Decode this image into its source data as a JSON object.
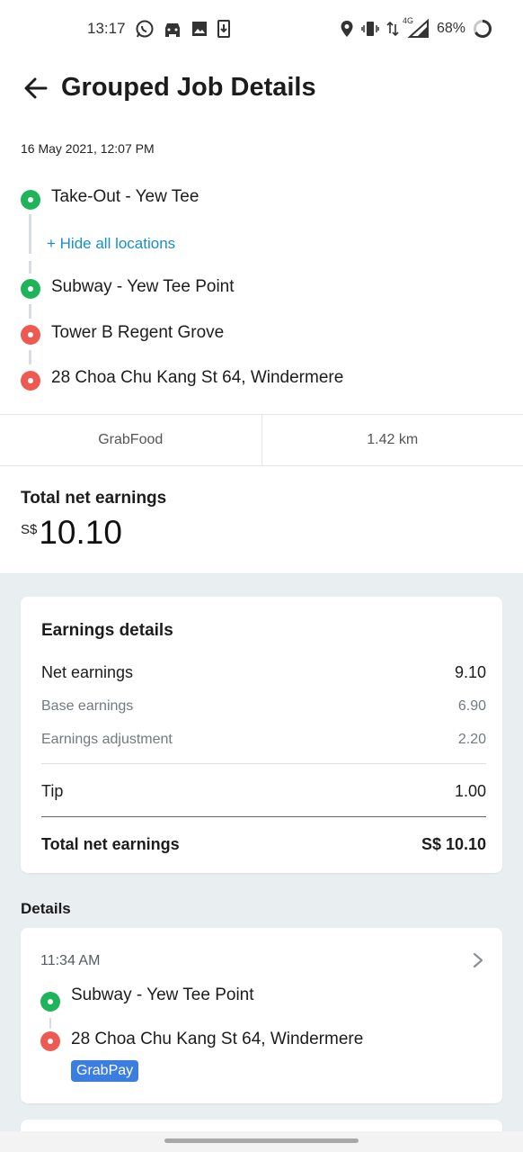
{
  "status_bar": {
    "time": "13:17",
    "network": "4G",
    "battery": "68%",
    "left_icons": [
      "whatsapp-icon",
      "car-icon",
      "image-icon",
      "download-icon"
    ],
    "right_icons": [
      "location-icon",
      "vibrate-icon",
      "data-arrows-icon",
      "signal-icon",
      "battery-ring-icon"
    ]
  },
  "header": {
    "title": "Grouped Job Details",
    "back_icon": "arrow-left-icon"
  },
  "job": {
    "date": "16 May 2021, 12:07 PM",
    "locations": [
      {
        "name": "Take-Out - Yew Tee",
        "type": "pickup"
      },
      {
        "name": "Subway - Yew Tee Point",
        "type": "pickup"
      },
      {
        "name": "Tower B Regent Grove",
        "type": "dropoff"
      },
      {
        "name": "28 Choa Chu Kang St 64, Windermere",
        "type": "dropoff"
      }
    ],
    "hide_link": "+ Hide all locations",
    "service": "GrabFood",
    "distance": "1.42 km"
  },
  "summary": {
    "label": "Total net earnings",
    "currency": "S$",
    "amount": "10.10"
  },
  "earnings_details": {
    "title": "Earnings details",
    "net_label": "Net earnings",
    "net_value": "9.10",
    "base_label": "Base earnings",
    "base_value": "6.90",
    "adj_label": "Earnings adjustment",
    "adj_value": "2.20",
    "tip_label": "Tip",
    "tip_value": "1.00",
    "total_label": "Total net earnings",
    "total_value": "S$ 10.10"
  },
  "details": {
    "title": "Details",
    "job": {
      "time": "11:34 AM",
      "pickup": "Subway - Yew Tee Point",
      "dropoff": "28 Choa Chu Kang St 64, Windermere",
      "payment": "GrabPay"
    }
  },
  "colors": {
    "pickup": "#1fb45a",
    "dropoff": "#ee5a52",
    "link": "#1a8fc6",
    "badge": "#3b7ee0",
    "background_grey": "#e9eef1"
  }
}
